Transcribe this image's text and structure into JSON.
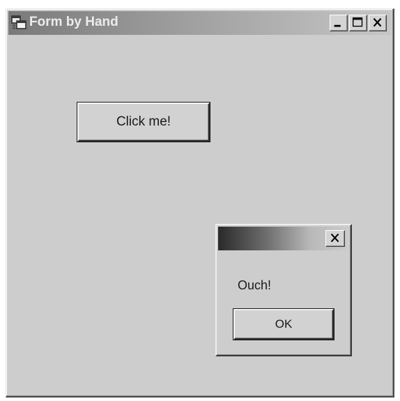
{
  "window": {
    "title": "Form by Hand",
    "icon": "app-window-icon",
    "caption_buttons": {
      "minimize": "minimize-icon",
      "maximize": "maximize-icon",
      "close": "close-icon"
    }
  },
  "form": {
    "click_button_label": "Click me!"
  },
  "message_box": {
    "title": "",
    "close_icon": "close-icon",
    "message": "Ouch!",
    "ok_label": "OK"
  },
  "colors": {
    "form_background": "#cdcdcd",
    "titlebar_start": "#7a7a7a",
    "titlebar_end": "#c6c6c6",
    "message_titlebar_start": "#2a2a2a"
  }
}
